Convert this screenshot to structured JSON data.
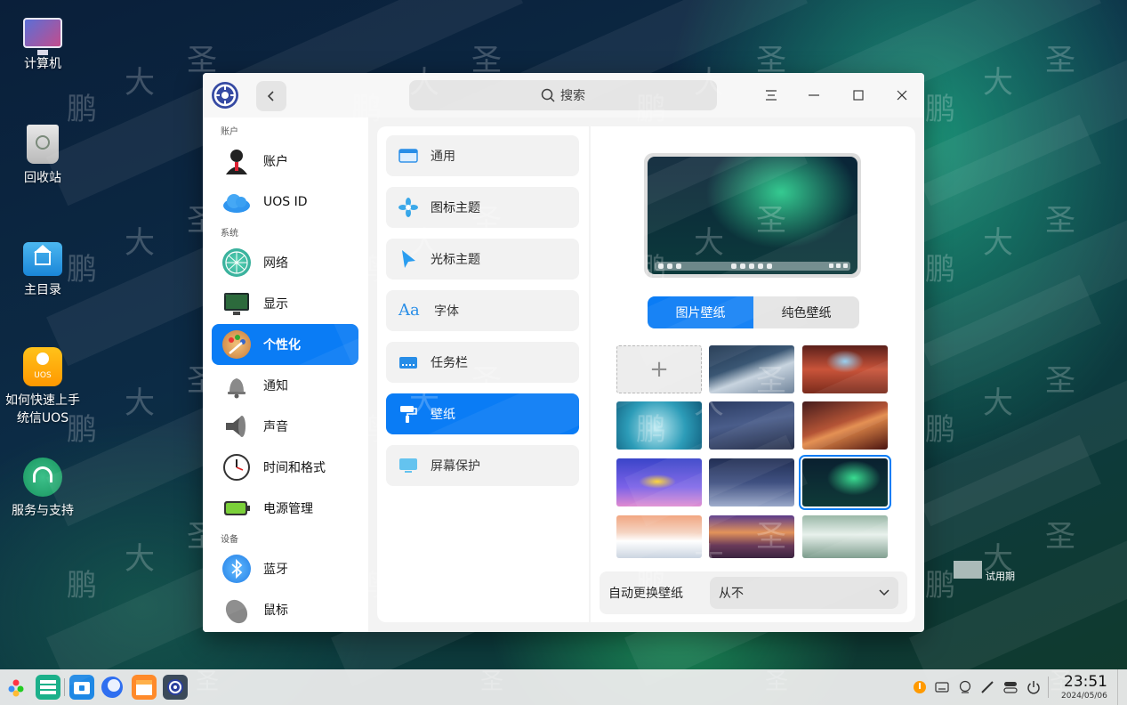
{
  "desktop": {
    "icons": [
      {
        "label": "计算机"
      },
      {
        "label": "回收站"
      },
      {
        "label": "主目录"
      },
      {
        "label": "如何快速上手统信UOS"
      },
      {
        "label": "服务与支持"
      }
    ],
    "uos_badge": "UOS",
    "trial_text": "试用期",
    "watermark": [
      "鹏",
      "大",
      "圣"
    ]
  },
  "window": {
    "search_label": "搜索",
    "sidebar": {
      "groups": [
        "账户",
        "系统",
        "设备"
      ],
      "items": [
        {
          "label": "账户",
          "group": "账户"
        },
        {
          "label": "UOS ID",
          "group": "账户"
        },
        {
          "label": "网络",
          "group": "系统"
        },
        {
          "label": "显示",
          "group": "系统"
        },
        {
          "label": "个性化",
          "group": "系统",
          "active": true
        },
        {
          "label": "通知",
          "group": "系统"
        },
        {
          "label": "声音",
          "group": "系统"
        },
        {
          "label": "时间和格式",
          "group": "系统"
        },
        {
          "label": "电源管理",
          "group": "系统"
        },
        {
          "label": "蓝牙",
          "group": "设备"
        },
        {
          "label": "鼠标",
          "group": "设备"
        }
      ]
    },
    "personalization_menu": [
      {
        "label": "通用"
      },
      {
        "label": "图标主题"
      },
      {
        "label": "光标主题"
      },
      {
        "label": "字体",
        "icon_text": "Aa"
      },
      {
        "label": "任务栏"
      },
      {
        "label": "壁纸",
        "active": true
      },
      {
        "label": "屏幕保护"
      }
    ],
    "wallpaper": {
      "tabs": [
        {
          "label": "图片壁纸",
          "active": true
        },
        {
          "label": "纯色壁纸"
        }
      ],
      "add_symbol": "+",
      "auto_change_label": "自动更换壁纸",
      "auto_change_value": "从不"
    }
  },
  "taskbar": {
    "time": "23:51",
    "date": "2024/05/06"
  },
  "colors": {
    "accent": "#0a7cf5",
    "window_bg": "#f3f3f3",
    "panel_bg": "#ffffff"
  }
}
